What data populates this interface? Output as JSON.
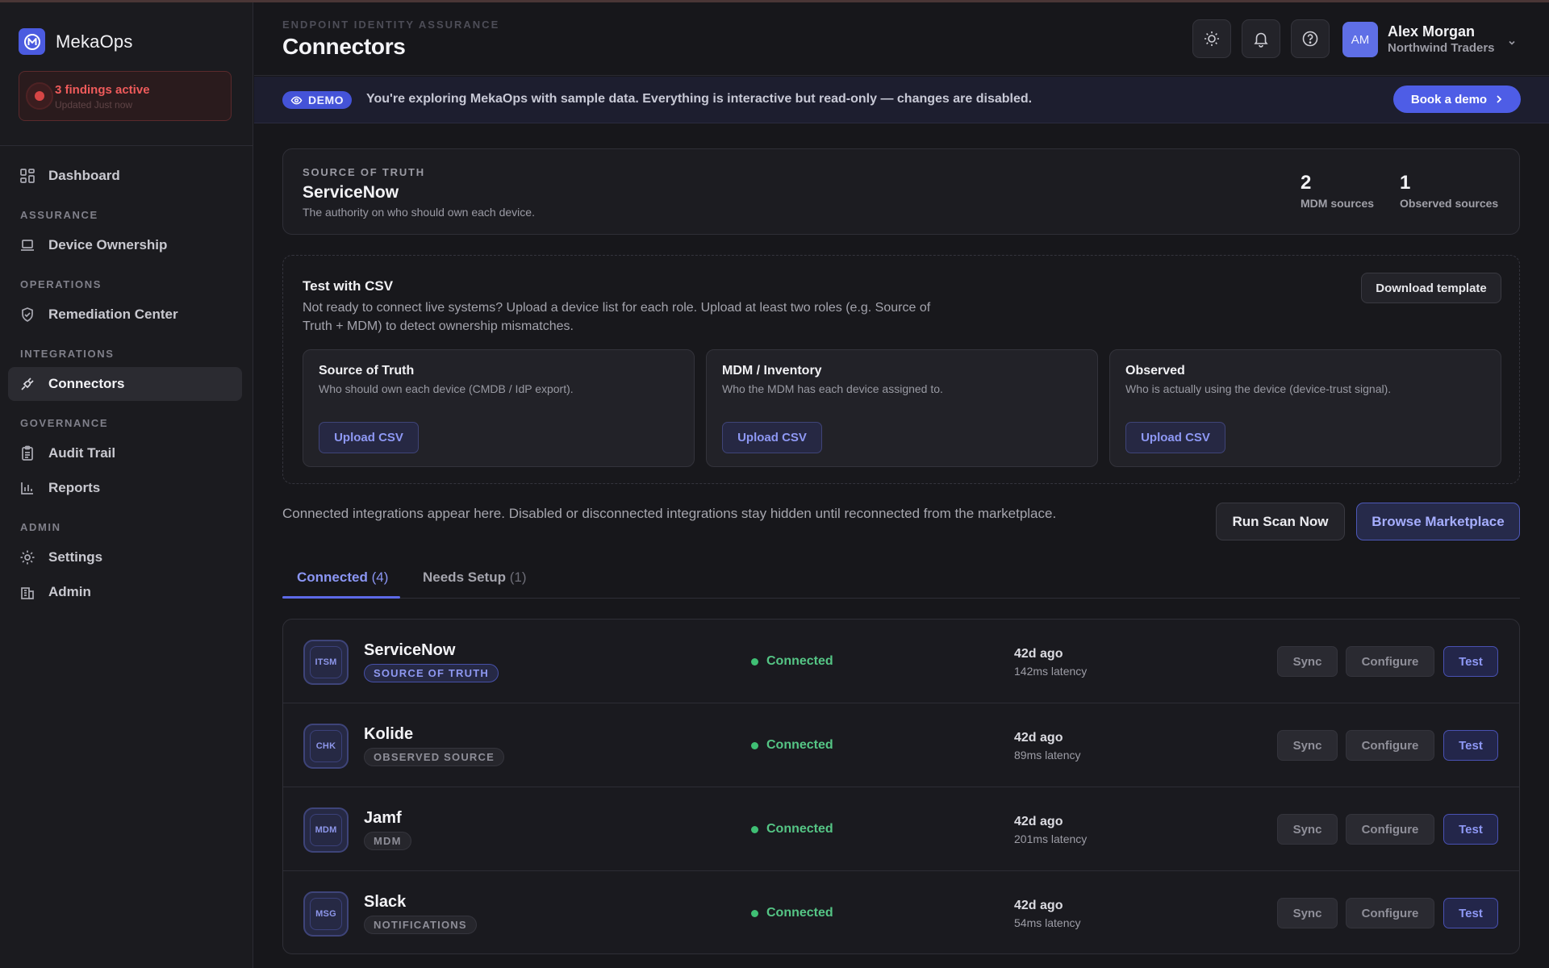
{
  "app": {
    "name": "MekaOps"
  },
  "findings": {
    "title": "3 findings active",
    "subtitle": "Updated Just now"
  },
  "sidebar": {
    "dashboard": "Dashboard",
    "sections": {
      "assurance": "ASSURANCE",
      "operations": "OPERATIONS",
      "integrations": "INTEGRATIONS",
      "governance": "GOVERNANCE",
      "admin": "ADMIN"
    },
    "items": {
      "device_ownership": "Device Ownership",
      "remediation_center": "Remediation Center",
      "connectors": "Connectors",
      "audit_trail": "Audit Trail",
      "reports": "Reports",
      "settings": "Settings",
      "admin": "Admin"
    },
    "active": "connectors"
  },
  "header": {
    "eyebrow": "ENDPOINT IDENTITY ASSURANCE",
    "title": "Connectors",
    "user": {
      "initials": "AM",
      "name": "Alex Morgan",
      "org": "Northwind Traders"
    }
  },
  "banner": {
    "badge": "DEMO",
    "text": "You're exploring MekaOps with sample data. Everything is interactive but read-only — changes are disabled.",
    "cta": "Book a demo"
  },
  "source_of_truth": {
    "label": "SOURCE OF TRUTH",
    "name": "ServiceNow",
    "description": "The authority on who should own each device.",
    "stats": [
      {
        "value": "2",
        "label": "MDM sources"
      },
      {
        "value": "1",
        "label": "Observed sources"
      }
    ]
  },
  "csv": {
    "title": "Test with CSV",
    "description": "Not ready to connect live systems? Upload a device list for each role. Upload at least two roles (e.g. Source of Truth + MDM) to detect ownership mismatches.",
    "download_label": "Download template",
    "roles": [
      {
        "title": "Source of Truth",
        "description": "Who should own each device (CMDB / IdP export).",
        "button": "Upload CSV"
      },
      {
        "title": "MDM / Inventory",
        "description": "Who the MDM has each device assigned to.",
        "button": "Upload CSV"
      },
      {
        "title": "Observed",
        "description": "Who is actually using the device (device-trust signal).",
        "button": "Upload CSV"
      }
    ]
  },
  "integrations": {
    "note": "Connected integrations appear here. Disabled or disconnected integrations stay hidden until reconnected from the marketplace.",
    "run_scan": "Run Scan Now",
    "browse": "Browse Marketplace"
  },
  "tabs": [
    {
      "label": "Connected",
      "count": "(4)",
      "active": true
    },
    {
      "label": "Needs Setup",
      "count": "(1)",
      "active": false
    }
  ],
  "connectors": [
    {
      "icon_text": "ITSM",
      "name": "ServiceNow",
      "tag": "SOURCE OF TRUTH",
      "tag_style": "primary",
      "status": "Connected",
      "last_sync": "42d ago",
      "latency": "142ms latency",
      "actions": {
        "sync": "Sync",
        "configure": "Configure",
        "test": "Test"
      }
    },
    {
      "icon_text": "CHK",
      "name": "Kolide",
      "tag": "OBSERVED SOURCE",
      "tag_style": "neutral",
      "status": "Connected",
      "last_sync": "42d ago",
      "latency": "89ms latency",
      "actions": {
        "sync": "Sync",
        "configure": "Configure",
        "test": "Test"
      }
    },
    {
      "icon_text": "MDM",
      "name": "Jamf",
      "tag": "MDM",
      "tag_style": "neutral",
      "status": "Connected",
      "last_sync": "42d ago",
      "latency": "201ms latency",
      "actions": {
        "sync": "Sync",
        "configure": "Configure",
        "test": "Test"
      }
    },
    {
      "icon_text": "MSG",
      "name": "Slack",
      "tag": "NOTIFICATIONS",
      "tag_style": "neutral",
      "status": "Connected",
      "last_sync": "42d ago",
      "latency": "54ms latency",
      "actions": {
        "sync": "Sync",
        "configure": "Configure",
        "test": "Test"
      }
    }
  ],
  "colors": {
    "accent": "#5d6ae8",
    "danger": "#ef5b5b",
    "success": "#3fbf74",
    "background": "#17171b"
  },
  "icons": {
    "brand": "meka-logo-icon",
    "theme": "sun-icon",
    "notifications": "bell-icon",
    "help": "question-circle-icon",
    "user_menu": "chevron-down-icon"
  }
}
